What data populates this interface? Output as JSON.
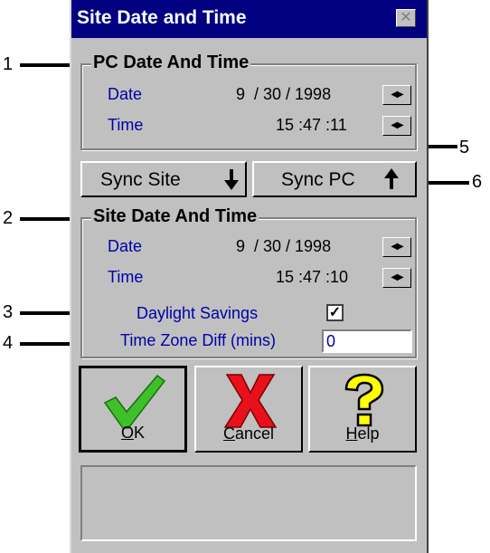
{
  "callouts": [
    "1",
    "2",
    "3",
    "4",
    "5",
    "6"
  ],
  "window": {
    "title": "Site Date and Time",
    "close_glyph": "✕"
  },
  "pc_group": {
    "title": "PC Date And Time",
    "date_label": "Date",
    "date_value": "9  / 30 / 1998",
    "time_label": "Time",
    "time_value": "15 :47 :11"
  },
  "sync": {
    "site_label": "Sync Site",
    "pc_label": "Sync PC"
  },
  "site_group": {
    "title": "Site Date And Time",
    "date_label": "Date",
    "date_value": "9  / 30 / 1998",
    "time_label": "Time",
    "time_value": "15 :47 :10",
    "daylight_label": "Daylight Savings",
    "daylight_checked": "✓",
    "tz_label": "Time Zone Diff (mins)",
    "tz_value": "0"
  },
  "buttons": {
    "ok_key": "O",
    "ok_rest": "K",
    "cancel_key": "C",
    "cancel_rest": "ancel",
    "help_key": "H",
    "help_rest": "elp"
  },
  "icons": {
    "ok": "check-icon",
    "cancel": "x-icon",
    "help": "question-icon"
  },
  "colors": {
    "title_bar": "#000080",
    "label_blue": "#0000a8",
    "check_green": "#3fbf2a",
    "x_red": "#e8101a",
    "help_yellow": "#ffff00"
  }
}
